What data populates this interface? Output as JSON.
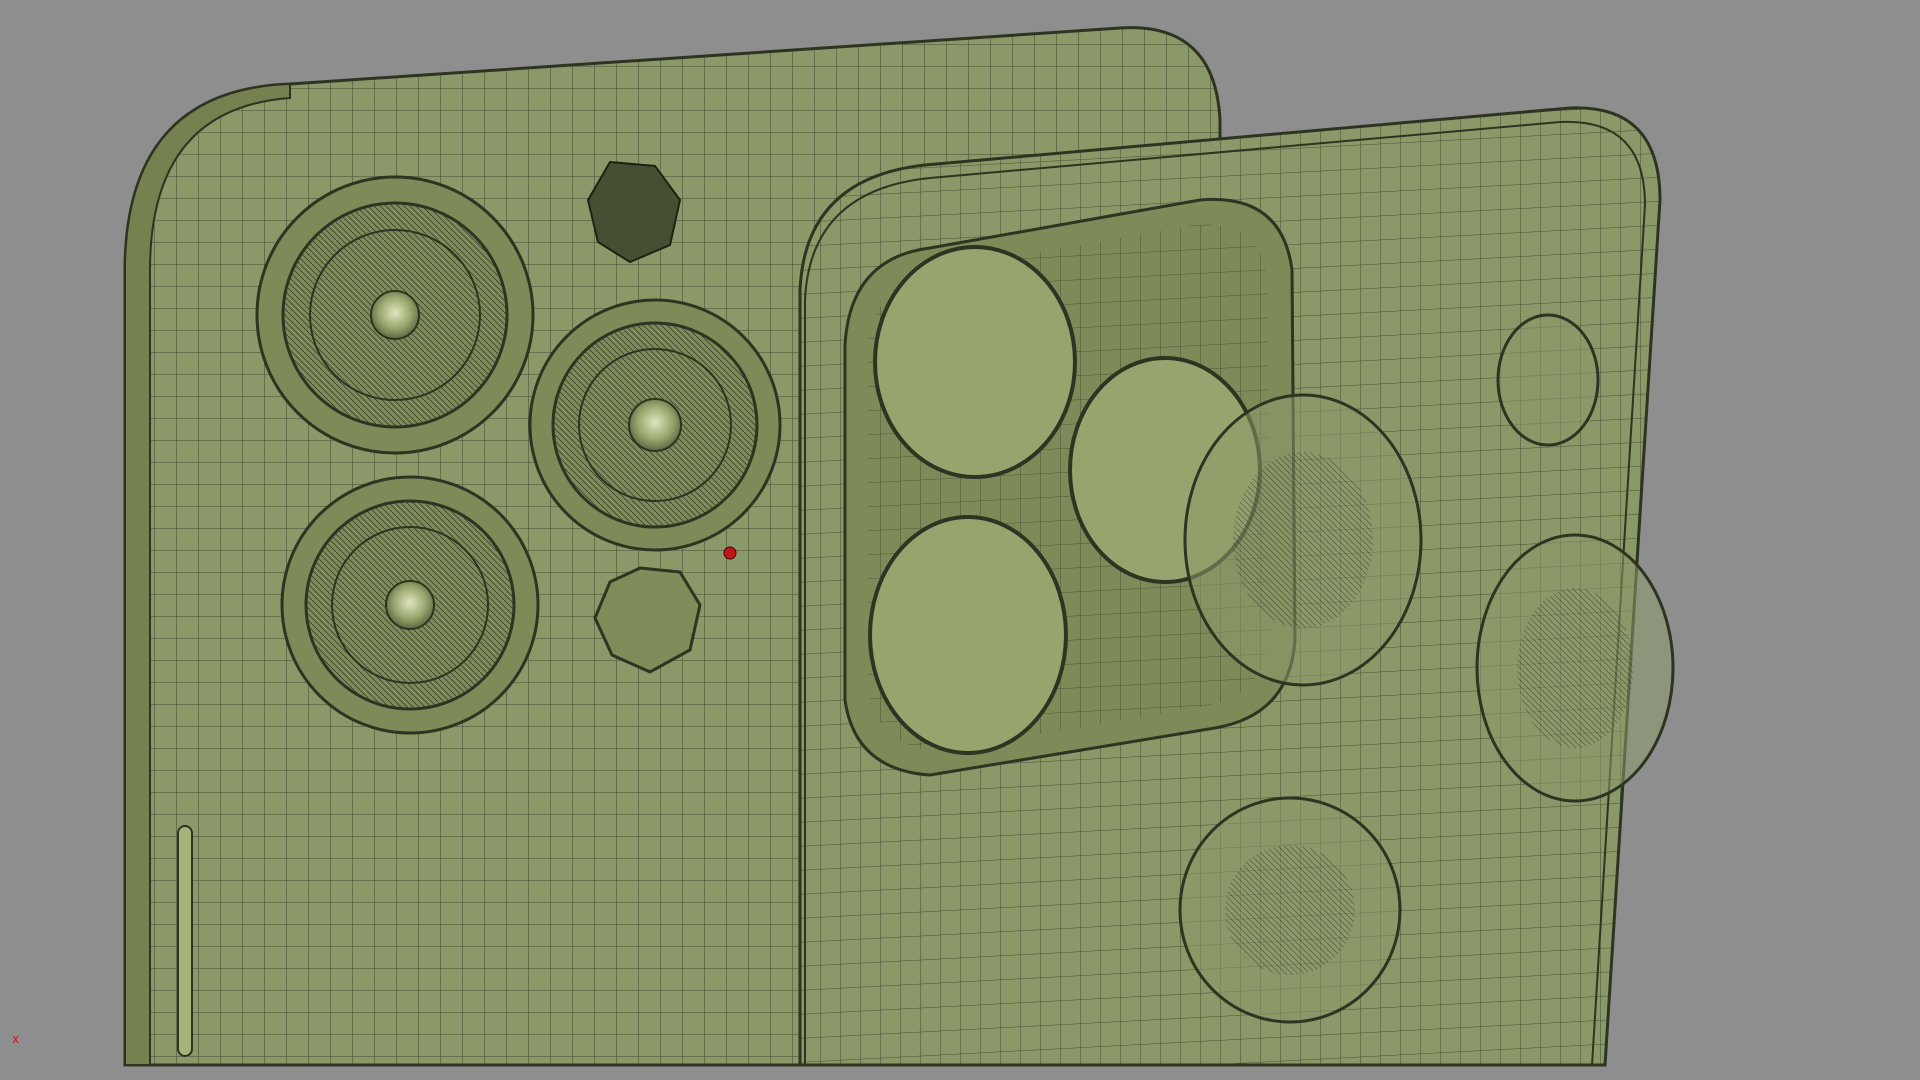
{
  "viewport": {
    "background": "#8e8e8e",
    "shading": "flat-wireframe",
    "axis_indicator": "x"
  },
  "scene": {
    "description_visible": false,
    "mesh_color": "#8b9868",
    "mesh_shadow": "#6f7b4e",
    "wire_color": "#2e3421",
    "objects": [
      {
        "id": "phone-back-left",
        "kind": "phone-back-mesh",
        "camera_lenses": 3,
        "flash": 1,
        "mic": 1
      },
      {
        "id": "phone-case-right",
        "kind": "case-mesh",
        "openings": 3,
        "buttons": 4
      }
    ],
    "selected_vertex_color": "#c01818"
  }
}
